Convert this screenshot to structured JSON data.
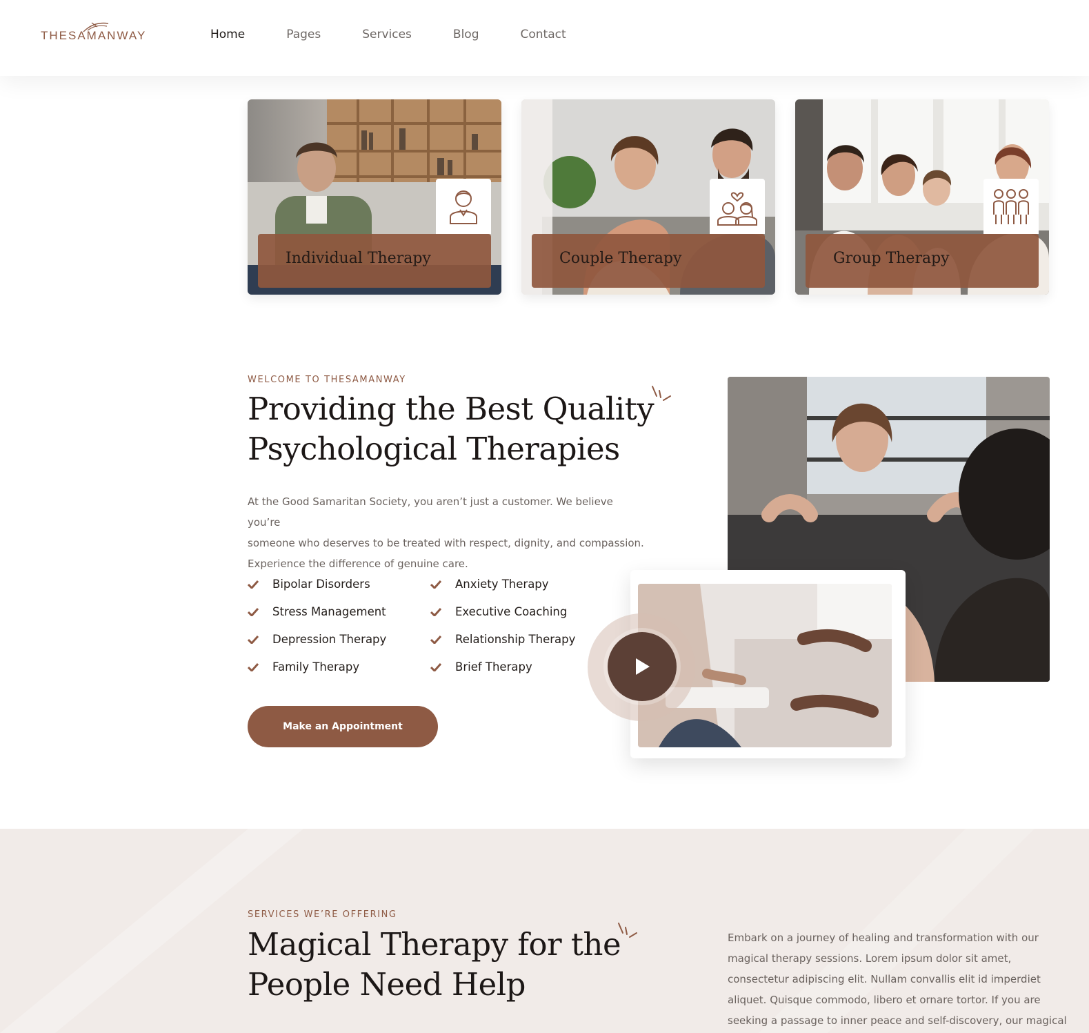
{
  "brand": {
    "logo_text": "THESAMANWAY",
    "accent_color": "#8e5a44"
  },
  "nav": [
    {
      "label": "Home",
      "active": true
    },
    {
      "label": "Pages",
      "active": false
    },
    {
      "label": "Services",
      "active": false
    },
    {
      "label": "Blog",
      "active": false
    },
    {
      "label": "Contact",
      "active": false
    }
  ],
  "cards": [
    {
      "title": "Individual Therapy",
      "icon": "person-icon"
    },
    {
      "title": "Couple Therapy",
      "icon": "couple-heart-icon"
    },
    {
      "title": "Group Therapy",
      "icon": "group-icon"
    }
  ],
  "welcome": {
    "eyebrow": "WELCOME TO THESAMANWAY",
    "headline_line1": "Providing the Best Quality",
    "headline_line2": "Psychological Therapies",
    "para_line1": "At the Good Samaritan Society, you aren’t just a customer. We believe you’re",
    "para_line2": "someone who deserves to be treated with respect, dignity, and compassion.",
    "para_line3": "Experience the difference of genuine care.",
    "checks_left": [
      "Bipolar Disorders",
      "Stress Management",
      "Depression Therapy",
      "Family Therapy"
    ],
    "checks_right": [
      "Anxiety Therapy",
      "Executive Coaching",
      "Relationship Therapy",
      "Brief Therapy"
    ],
    "button_label": "Make an Appointment"
  },
  "services": {
    "eyebrow": "SERVICES WE’RE OFFERING",
    "headline_line1": "Magical Therapy for the",
    "headline_line2": "People Need Help",
    "para_lines": [
      "Embark on a journey of healing and transformation with our",
      "magical therapy sessions. Lorem ipsum dolor sit amet,",
      "consectetur adipiscing elit. Nullam convallis elit id imperdiet",
      "aliquet. Quisque commodo, libero et ornare tortor. If you are",
      "seeking a passage to inner peace and self-discovery, our magical"
    ]
  }
}
